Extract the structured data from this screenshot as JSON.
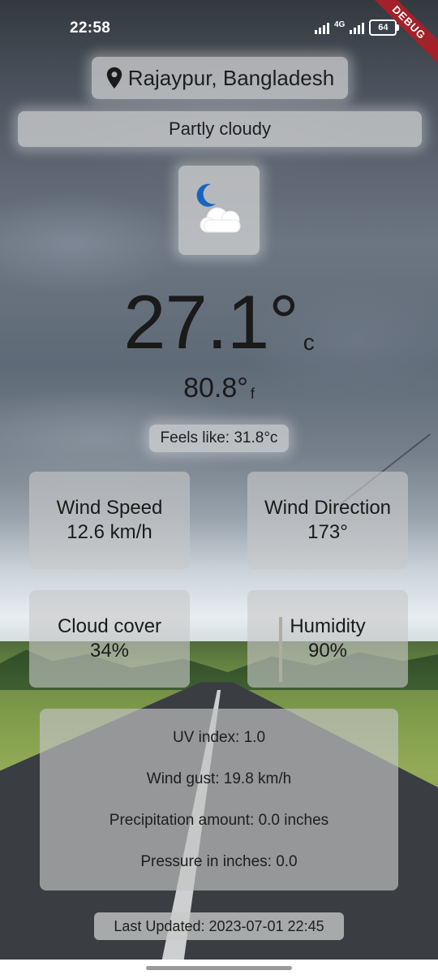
{
  "status_bar": {
    "time": "22:58",
    "network": "4G",
    "battery": "64",
    "debug_banner": "DEBUG"
  },
  "location": {
    "icon": "location-pin-icon",
    "name": "Rajaypur, Bangladesh"
  },
  "condition": {
    "text": "Partly cloudy",
    "icon": "moon-cloud-icon"
  },
  "temperature": {
    "celsius": "27.1°",
    "celsius_unit": "c",
    "fahrenheit": "80.8°",
    "fahrenheit_unit": "f"
  },
  "feels_like": "Feels like: 31.8°c",
  "tiles": {
    "wind_speed": {
      "label": "Wind Speed",
      "value": "12.6 km/h"
    },
    "wind_direction": {
      "label": "Wind Direction",
      "value": "173°"
    },
    "cloud_cover": {
      "label": "Cloud cover",
      "value": "34%"
    },
    "humidity": {
      "label": "Humidity",
      "value": "90%"
    }
  },
  "details": [
    "UV index: 1.0",
    "Wind gust: 19.8 km/h",
    "Precipitation amount: 0.0 inches",
    "Pressure in inches: 0.0"
  ],
  "last_updated": "Last Updated: 2023-07-01 22:45",
  "colors": {
    "debug_banner": "#a3212a",
    "moon": "#1565c0",
    "panel": "#d7d7d7"
  }
}
